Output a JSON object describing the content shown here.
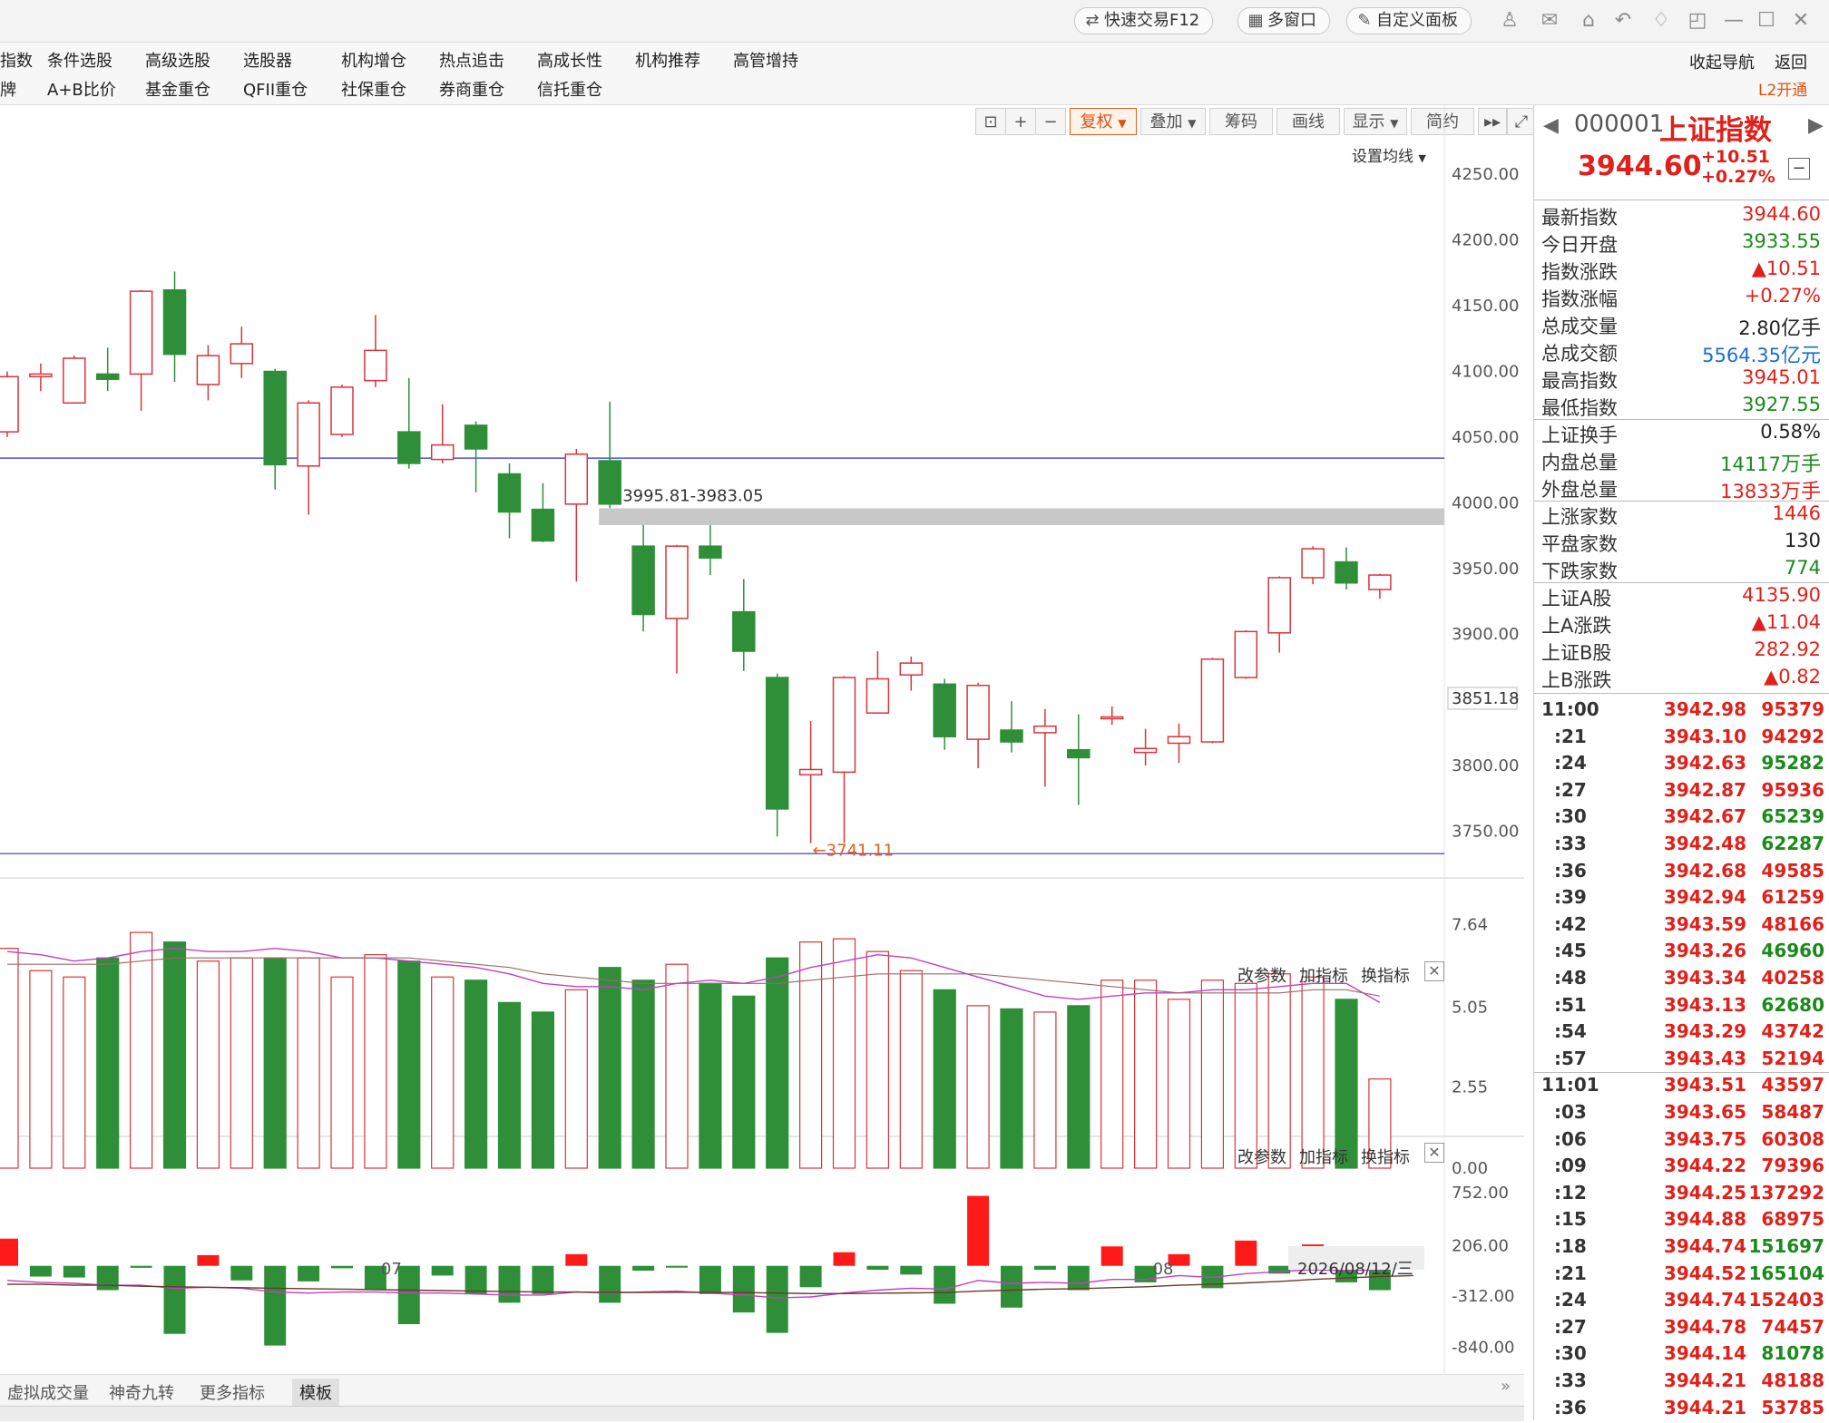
{
  "toolbar_top": {
    "quick_trade": "快速交易F12",
    "multi_window": "多窗口",
    "custom_panel": "自定义面板"
  },
  "menu": {
    "row1": [
      "指数",
      "条件选股",
      "高级选股",
      "选股器",
      "机构增仓",
      "热点追击",
      "高成长性",
      "机构推荐",
      "高管增持"
    ],
    "row2": [
      "牌",
      "A+B比价",
      "基金重仓",
      "QFII重仓",
      "社保重仓",
      "券商重仓",
      "信托重仓"
    ],
    "collapse_nav": "收起导航",
    "back": "返回",
    "l2": "L2开通"
  },
  "chart_toolbar": {
    "restore": "复权",
    "overlay": "叠加",
    "chips": "筹码",
    "draw": "画线",
    "display": "显示",
    "simple": "简约",
    "set_ma": "设置均线"
  },
  "chart_data": {
    "type": "candlestick",
    "ylim": [
      3720,
      4275
    ],
    "yticks": [
      "4250.00",
      "4200.00",
      "4150.00",
      "4100.00",
      "4050.00",
      "4000.00",
      "3950.00",
      "3900.00",
      "3850.00",
      "3800.00",
      "3750.00"
    ],
    "current_price_label": "3851.18",
    "gap_label": "3995.81-3983.05",
    "gap_range": [
      3983.05,
      3995.81
    ],
    "low_label": "←3741.11",
    "h_lines": [
      4034,
      3733
    ],
    "x_labels": [
      "07",
      "08"
    ],
    "date_label": "2026/08/12/三",
    "candles": [
      {
        "o": 4054,
        "c": 4096,
        "h": 4100,
        "l": 4050
      },
      {
        "o": 4096,
        "c": 4098,
        "h": 4106,
        "l": 4085
      },
      {
        "o": 4076,
        "c": 4110,
        "h": 4112,
        "l": 4076
      },
      {
        "o": 4098,
        "c": 4094,
        "h": 4118,
        "l": 4085
      },
      {
        "o": 4098,
        "c": 4161,
        "h": 4162,
        "l": 4070
      },
      {
        "o": 4162,
        "c": 4113,
        "h": 4176,
        "l": 4092
      },
      {
        "o": 4090,
        "c": 4112,
        "h": 4120,
        "l": 4078
      },
      {
        "o": 4106,
        "c": 4121,
        "h": 4134,
        "l": 4095
      },
      {
        "o": 4100,
        "c": 4029,
        "h": 4102,
        "l": 4010
      },
      {
        "o": 4028,
        "c": 4076,
        "h": 4078,
        "l": 3991
      },
      {
        "o": 4052,
        "c": 4088,
        "h": 4090,
        "l": 4050
      },
      {
        "o": 4093,
        "c": 4116,
        "h": 4143,
        "l": 4088
      },
      {
        "o": 4054,
        "c": 4030,
        "h": 4095,
        "l": 4026
      },
      {
        "o": 4033,
        "c": 4044,
        "h": 4075,
        "l": 4030
      },
      {
        "o": 4059,
        "c": 4041,
        "h": 4062,
        "l": 4008
      },
      {
        "o": 4022,
        "c": 3993,
        "h": 4030,
        "l": 3973
      },
      {
        "o": 3995,
        "c": 3971,
        "h": 4015,
        "l": 3970
      },
      {
        "o": 3999,
        "c": 4037,
        "h": 4041,
        "l": 3940
      },
      {
        "o": 4032,
        "c": 3999,
        "h": 4077,
        "l": 3996
      },
      {
        "o": 3967,
        "c": 3915,
        "h": 3983,
        "l": 3902
      },
      {
        "o": 3912,
        "c": 3967,
        "h": 3968,
        "l": 3870
      },
      {
        "o": 3967,
        "c": 3958,
        "h": 3983,
        "l": 3945
      },
      {
        "o": 3917,
        "c": 3887,
        "h": 3942,
        "l": 3872
      },
      {
        "o": 3867,
        "c": 3767,
        "h": 3870,
        "l": 3746
      },
      {
        "o": 3793,
        "c": 3797,
        "h": 3834,
        "l": 3741
      },
      {
        "o": 3795,
        "c": 3867,
        "h": 3868,
        "l": 3741
      },
      {
        "o": 3840,
        "c": 3866,
        "h": 3887,
        "l": 3840
      },
      {
        "o": 3869,
        "c": 3878,
        "h": 3883,
        "l": 3857
      },
      {
        "o": 3862,
        "c": 3822,
        "h": 3866,
        "l": 3812
      },
      {
        "o": 3820,
        "c": 3861,
        "h": 3863,
        "l": 3798
      },
      {
        "o": 3827,
        "c": 3818,
        "h": 3849,
        "l": 3810
      },
      {
        "o": 3825,
        "c": 3830,
        "h": 3843,
        "l": 3784
      },
      {
        "o": 3812,
        "c": 3806,
        "h": 3839,
        "l": 3770
      },
      {
        "o": 3837,
        "c": 3837,
        "h": 3845,
        "l": 3831
      },
      {
        "o": 3810,
        "c": 3813,
        "h": 3828,
        "l": 3800
      },
      {
        "o": 3817,
        "c": 3822,
        "h": 3832,
        "l": 3802
      },
      {
        "o": 3818,
        "c": 3881,
        "h": 3882,
        "l": 3817
      },
      {
        "o": 3867,
        "c": 3902,
        "h": 3903,
        "l": 3866
      },
      {
        "o": 3901,
        "c": 3943,
        "h": 3944,
        "l": 3886
      },
      {
        "o": 3943,
        "c": 3965,
        "h": 3967,
        "l": 3938
      },
      {
        "o": 3955,
        "c": 3939,
        "h": 3966,
        "l": 3934
      },
      {
        "o": 3934,
        "c": 3945,
        "h": 3946,
        "l": 3927
      }
    ],
    "volume": {
      "yticks": [
        "7.64",
        "5.05",
        "2.55",
        "0.00"
      ],
      "ylim": [
        0,
        8.2
      ],
      "values": [
        6.9,
        6.2,
        6.0,
        6.6,
        7.4,
        7.1,
        6.5,
        6.6,
        6.6,
        6.6,
        6.0,
        6.7,
        6.5,
        6.0,
        5.9,
        5.2,
        4.9,
        5.6,
        6.3,
        5.9,
        6.4,
        5.8,
        5.4,
        6.6,
        7.1,
        7.2,
        6.8,
        6.2,
        5.6,
        5.1,
        5.0,
        4.9,
        5.1,
        5.9,
        5.9,
        5.3,
        5.9,
        5.8,
        6.1,
        6.0,
        5.3,
        2.8
      ],
      "ma1": [
        6.8,
        6.7,
        6.5,
        6.6,
        6.8,
        6.9,
        6.8,
        6.8,
        6.9,
        6.8,
        6.6,
        6.6,
        6.5,
        6.4,
        6.3,
        6.1,
        5.8,
        5.7,
        5.7,
        5.6,
        5.8,
        5.9,
        5.8,
        6.0,
        6.3,
        6.5,
        6.7,
        6.6,
        6.3,
        6.0,
        5.7,
        5.4,
        5.3,
        5.4,
        5.5,
        5.5,
        5.6,
        5.6,
        5.7,
        5.8,
        5.8,
        5.2
      ],
      "ma2": [
        6.4,
        6.4,
        6.4,
        6.4,
        6.5,
        6.6,
        6.6,
        6.6,
        6.6,
        6.6,
        6.6,
        6.6,
        6.6,
        6.5,
        6.4,
        6.3,
        6.1,
        6.0,
        5.9,
        5.8,
        5.8,
        5.8,
        5.8,
        5.8,
        5.9,
        6.0,
        6.1,
        6.1,
        6.1,
        6.1,
        6.0,
        5.9,
        5.8,
        5.7,
        5.6,
        5.5,
        5.5,
        5.5,
        5.5,
        5.6,
        5.6,
        5.4
      ]
    },
    "macd": {
      "yticks": [
        "752.00",
        "206.00",
        "-312.00",
        "-840.00"
      ],
      "ylim": [
        -880,
        800
      ],
      "values": [
        280,
        -110,
        -120,
        -250,
        -20,
        -700,
        110,
        -150,
        -820,
        -160,
        -25,
        -240,
        -600,
        -100,
        -290,
        -380,
        -290,
        120,
        -380,
        -50,
        -2,
        -290,
        -480,
        -690,
        -220,
        140,
        -40,
        -90,
        -390,
        720,
        -430,
        -40,
        -250,
        200,
        -170,
        120,
        -230,
        260,
        -80,
        220,
        -170,
        -250,
        -40
      ],
      "line1": [
        -150,
        -170,
        -180,
        -200,
        -200,
        -230,
        -220,
        -230,
        -270,
        -280,
        -270,
        -270,
        -280,
        -280,
        -290,
        -300,
        -300,
        -270,
        -280,
        -270,
        -260,
        -280,
        -300,
        -330,
        -320,
        -280,
        -250,
        -230,
        -240,
        -150,
        -180,
        -170,
        -180,
        -140,
        -140,
        -100,
        -120,
        -80,
        -60,
        -40,
        -50,
        -40,
        -20
      ],
      "line2": [
        -190,
        -190,
        -200,
        -200,
        -210,
        -215,
        -220,
        -225,
        -230,
        -235,
        -240,
        -245,
        -250,
        -255,
        -260,
        -265,
        -270,
        -270,
        -272,
        -273,
        -272,
        -273,
        -275,
        -280,
        -285,
        -285,
        -282,
        -278,
        -275,
        -260,
        -250,
        -240,
        -235,
        -225,
        -215,
        -200,
        -190,
        -175,
        -160,
        -140,
        -125,
        -110,
        -100
      ]
    }
  },
  "subchart_controls": {
    "modify_params": "改参数",
    "add_indicator": "加指标",
    "switch_indicator": "换指标"
  },
  "bottom_tabs": [
    "虚拟成交量",
    "神奇九转",
    "更多指标",
    "模板"
  ],
  "right_panel": {
    "code": "000001",
    "name": "上证指数",
    "price": "3944.60",
    "change": "+10.51",
    "change_pct": "+0.27%",
    "stats": [
      {
        "label": "最新指数",
        "value": "3944.60",
        "color": "red"
      },
      {
        "label": "今日开盘",
        "value": "3933.55",
        "color": "green"
      },
      {
        "label": "指数涨跌",
        "value": "▲10.51",
        "color": "red"
      },
      {
        "label": "指数涨幅",
        "value": "+0.27%",
        "color": "red"
      },
      {
        "label": "总成交量",
        "value": "2.80",
        "unit": "亿手",
        "color": "black"
      },
      {
        "label": "总成交额",
        "value": "5564.35",
        "unit": "亿元",
        "color": "blue"
      },
      {
        "label": "最高指数",
        "value": "3945.01",
        "color": "red"
      },
      {
        "label": "最低指数",
        "value": "3927.55",
        "color": "green"
      },
      {
        "label": "上证换手",
        "value": "0.58%",
        "color": "black"
      },
      {
        "label": "内盘总量",
        "value": "14117",
        "unit": "万手",
        "color": "green"
      },
      {
        "label": "外盘总量",
        "value": "13833",
        "unit": "万手",
        "color": "red"
      },
      {
        "label": "上涨家数",
        "value": "1446",
        "color": "red"
      },
      {
        "label": "平盘家数",
        "value": "130",
        "color": "black"
      },
      {
        "label": "下跌家数",
        "value": "774",
        "color": "green"
      },
      {
        "label": "上证A股",
        "value": "4135.90",
        "color": "red"
      },
      {
        "label": "上A涨跌",
        "value": "▲11.04",
        "color": "red"
      },
      {
        "label": "上证B股",
        "value": "282.92",
        "color": "red"
      },
      {
        "label": "上B涨跌",
        "value": "▲0.82",
        "color": "red"
      }
    ],
    "ticks": [
      {
        "t": "11:00",
        "p": "3942.98",
        "v": "95379",
        "c": "red"
      },
      {
        "t": ":21",
        "p": "3943.10",
        "v": "94292",
        "c": "red"
      },
      {
        "t": ":24",
        "p": "3942.63",
        "v": "95282",
        "c": "green"
      },
      {
        "t": ":27",
        "p": "3942.87",
        "v": "95936",
        "c": "red"
      },
      {
        "t": ":30",
        "p": "3942.67",
        "v": "65239",
        "c": "green"
      },
      {
        "t": ":33",
        "p": "3942.48",
        "v": "62287",
        "c": "green"
      },
      {
        "t": ":36",
        "p": "3942.68",
        "v": "49585",
        "c": "red"
      },
      {
        "t": ":39",
        "p": "3942.94",
        "v": "61259",
        "c": "red"
      },
      {
        "t": ":42",
        "p": "3943.59",
        "v": "48166",
        "c": "red"
      },
      {
        "t": ":45",
        "p": "3943.26",
        "v": "46960",
        "c": "green"
      },
      {
        "t": ":48",
        "p": "3943.34",
        "v": "40258",
        "c": "red"
      },
      {
        "t": ":51",
        "p": "3943.13",
        "v": "62680",
        "c": "green"
      },
      {
        "t": ":54",
        "p": "3943.29",
        "v": "43742",
        "c": "red"
      },
      {
        "t": ":57",
        "p": "3943.43",
        "v": "52194",
        "c": "red"
      },
      {
        "t": "11:01",
        "p": "3943.51",
        "v": "43597",
        "c": "red"
      },
      {
        "t": ":03",
        "p": "3943.65",
        "v": "58487",
        "c": "red"
      },
      {
        "t": ":06",
        "p": "3943.75",
        "v": "60308",
        "c": "red"
      },
      {
        "t": ":09",
        "p": "3944.22",
        "v": "79396",
        "c": "red"
      },
      {
        "t": ":12",
        "p": "3944.25",
        "v": "137292",
        "c": "red"
      },
      {
        "t": ":15",
        "p": "3944.88",
        "v": "68975",
        "c": "red"
      },
      {
        "t": ":18",
        "p": "3944.74",
        "v": "151697",
        "c": "green"
      },
      {
        "t": ":21",
        "p": "3944.52",
        "v": "165104",
        "c": "green"
      },
      {
        "t": ":24",
        "p": "3944.74",
        "v": "152403",
        "c": "red"
      },
      {
        "t": ":27",
        "p": "3944.78",
        "v": "74457",
        "c": "red"
      },
      {
        "t": ":30",
        "p": "3944.14",
        "v": "81078",
        "c": "green"
      },
      {
        "t": ":33",
        "p": "3944.21",
        "v": "48188",
        "c": "red"
      },
      {
        "t": ":36",
        "p": "3944.21",
        "v": "53785",
        "c": "red"
      }
    ]
  }
}
